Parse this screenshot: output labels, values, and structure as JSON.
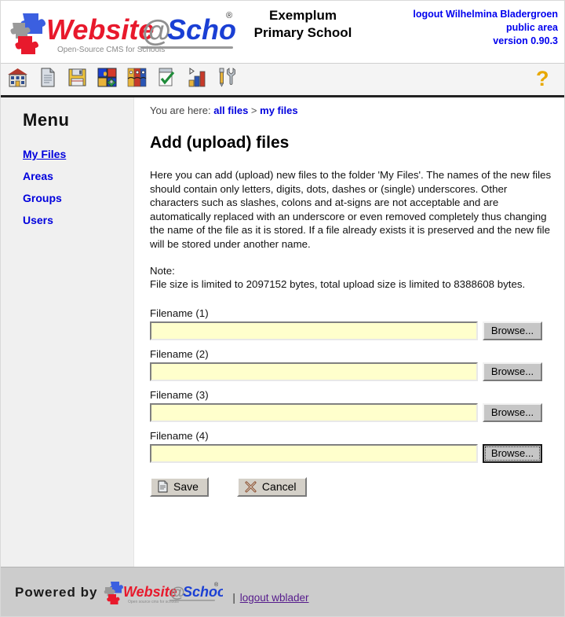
{
  "header": {
    "logo_text_website": "Website",
    "logo_text_at": "@",
    "logo_text_school": "School",
    "logo_tagline": "Open-Source CMS for Schools",
    "logo_registered": "®",
    "school_name_line1": "Exemplum",
    "school_name_line2": "Primary School",
    "logout_label": "logout Wilhelmina Bladergroen",
    "area_label": "public area",
    "version_label": "version 0.90.3"
  },
  "toolbar": {
    "icons": [
      {
        "name": "school-icon",
        "title": "School"
      },
      {
        "name": "page-icon",
        "title": "Page"
      },
      {
        "name": "save-disk-icon",
        "title": "Save"
      },
      {
        "name": "modules-icon",
        "title": "Modules"
      },
      {
        "name": "areas-icon",
        "title": "Areas"
      },
      {
        "name": "approve-icon",
        "title": "Approve"
      },
      {
        "name": "statistics-icon",
        "title": "Statistics"
      },
      {
        "name": "tools-icon",
        "title": "Tools"
      }
    ],
    "help_icon_label": "?"
  },
  "sidebar": {
    "title": "Menu",
    "items": [
      {
        "label": "My Files",
        "active": true
      },
      {
        "label": "Areas",
        "active": false
      },
      {
        "label": "Groups",
        "active": false
      },
      {
        "label": "Users",
        "active": false
      }
    ]
  },
  "breadcrumb": {
    "prefix": "You are here:",
    "crumb1": "all files",
    "separator": ">",
    "crumb2": "my files"
  },
  "main": {
    "page_title": "Add (upload) files",
    "paragraph1": "Here you can add (upload) new files to the folder 'My Files'. The names of the new files should contain only letters, digits, dots, dashes or (single) underscores. Other characters such as slashes, colons and at-signs are not acceptable and are automatically replaced with an underscore or even removed completely thus changing the name of the file as it is stored. If a file already exists it is preserved and the new file will be stored under another name.",
    "note_label": "Note:",
    "note_text": "File size is limited to 2097152 bytes, total upload size is limited to 8388608 bytes.",
    "fields": [
      {
        "label": "Filename (1)",
        "value": "",
        "browse_label": "Browse...",
        "focused": false
      },
      {
        "label": "Filename (2)",
        "value": "",
        "browse_label": "Browse...",
        "focused": false
      },
      {
        "label": "Filename (3)",
        "value": "",
        "browse_label": "Browse...",
        "focused": false
      },
      {
        "label": "Filename (4)",
        "value": "",
        "browse_label": "Browse...",
        "focused": true
      }
    ],
    "save_label": "Save",
    "cancel_label": "Cancel"
  },
  "footer": {
    "powered_label": "Powered by",
    "logo_text_website": "Website",
    "logo_text_at": "@",
    "logo_text_school": "School",
    "logo_tagline": "Open source cms for schools",
    "logo_registered": "®",
    "pipe": "|",
    "logout_label": "logout wblader"
  },
  "colors": {
    "link_blue": "#0000dd",
    "input_yellow": "#ffffcc",
    "footer_gray": "#cccccc",
    "sidebar_gray": "#f0f0f0",
    "logo_red": "#e8192c",
    "logo_blue": "#1a3fd4",
    "help_gold": "#e8a800"
  }
}
